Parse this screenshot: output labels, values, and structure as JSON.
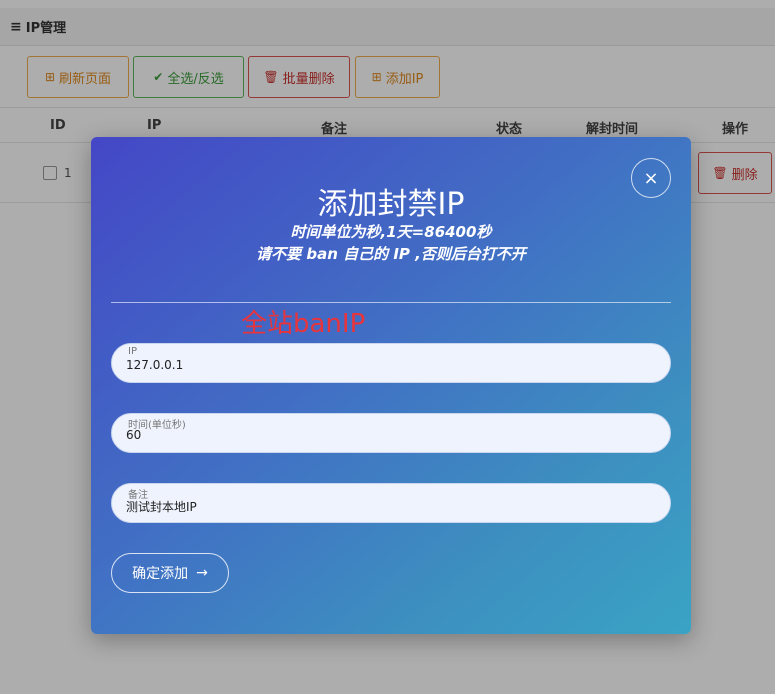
{
  "header": {
    "title": "IP管理",
    "menu_icon": "≡"
  },
  "toolbar": {
    "refresh_label": "刷新页面",
    "select_label": "全选/反选",
    "batch_delete_label": "批量删除",
    "add_label": "添加IP",
    "plus_icon": "⊞",
    "check_icon": "✔",
    "trash_icon": "🗑"
  },
  "table": {
    "columns": [
      "ID",
      "IP",
      "备注",
      "状态",
      "解封时间",
      "操作"
    ],
    "rows": [
      {
        "id": "1",
        "delete_label": "删除"
      }
    ]
  },
  "modal": {
    "title": "添加封禁IP",
    "subtitle_1": "时间单位为秒,1天=86400秒",
    "subtitle_2": "请不要 ban 自己的 IP ,否则后台打不开",
    "close_icon": "×",
    "red_label": "全站banIP",
    "fields": {
      "ip": {
        "label": "IP",
        "value": "127.0.0.1"
      },
      "time": {
        "label": "时间(单位秒)",
        "value": "60"
      },
      "note": {
        "label": "备注",
        "value": "测试封本地IP"
      }
    },
    "submit_label": "确定添加",
    "submit_arrow": "→"
  },
  "colors": {
    "accent_orange": "#f0ad4e",
    "accent_green": "#5cb85c",
    "accent_red": "#d9534f",
    "modal_start": "#4447c6",
    "modal_end": "#3aa3c4",
    "red_label": "#e8343c"
  }
}
